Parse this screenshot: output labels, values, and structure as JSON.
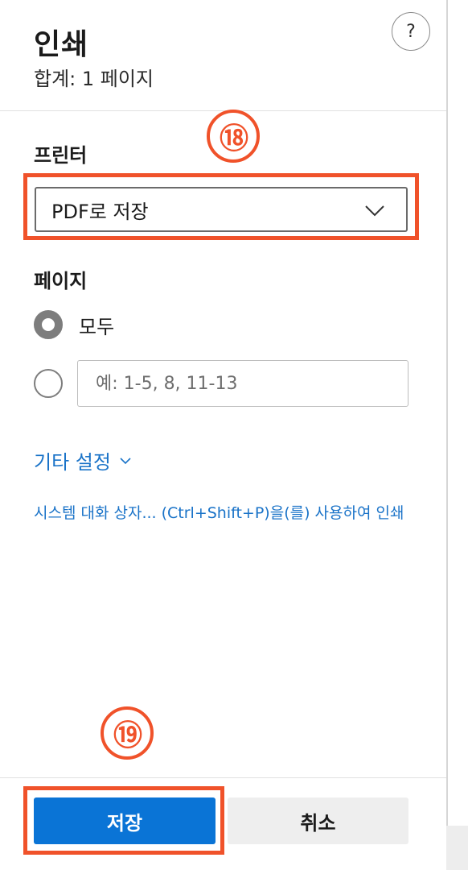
{
  "header": {
    "title": "인쇄",
    "subtitle": "합계: 1 페이지",
    "help_label": "?"
  },
  "annotations": {
    "marker_printer": "⑱",
    "marker_save": "⑲",
    "color": "#f0522a"
  },
  "printer": {
    "label": "프린터",
    "selected": "PDF로 저장"
  },
  "pages": {
    "label": "페이지",
    "option_all": "모두",
    "option_all_selected": true,
    "custom_placeholder": "예: 1-5, 8, 11-13"
  },
  "more_settings": {
    "label": "기타 설정"
  },
  "system_dialog": {
    "text": "시스템 대화 상자... (Ctrl+Shift+P)을(를) 사용하여 인쇄"
  },
  "footer": {
    "save_label": "저장",
    "cancel_label": "취소",
    "accent": "#0a74d6"
  }
}
